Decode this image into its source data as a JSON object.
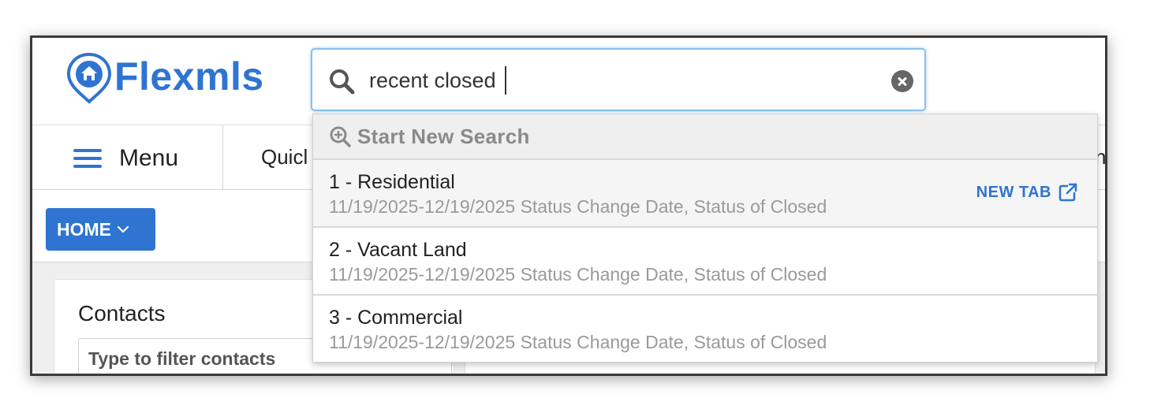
{
  "app": {
    "logo_text": "Flexmls",
    "brand_color": "#2f74d0"
  },
  "search": {
    "value": "recent closed",
    "clear_icon": "clear-circle-icon"
  },
  "nav": {
    "menu_label": "Menu",
    "quick_label": "Quicl",
    "right_fragment": "n"
  },
  "toolbar": {
    "home_label": "HOME"
  },
  "contacts": {
    "title": "Contacts",
    "filter_placeholder": "Type to filter contacts"
  },
  "dropdown": {
    "header_label": "Start New Search",
    "new_tab_label": "NEW TAB",
    "items": [
      {
        "title": "1 - Residential",
        "subtitle": "11/19/2025-12/19/2025 Status Change Date, Status of Closed"
      },
      {
        "title": "2 - Vacant Land",
        "subtitle": "11/19/2025-12/19/2025 Status Change Date, Status of Closed"
      },
      {
        "title": "3 - Commercial",
        "subtitle": "11/19/2025-12/19/2025 Status Change Date, Status of Closed"
      }
    ]
  }
}
